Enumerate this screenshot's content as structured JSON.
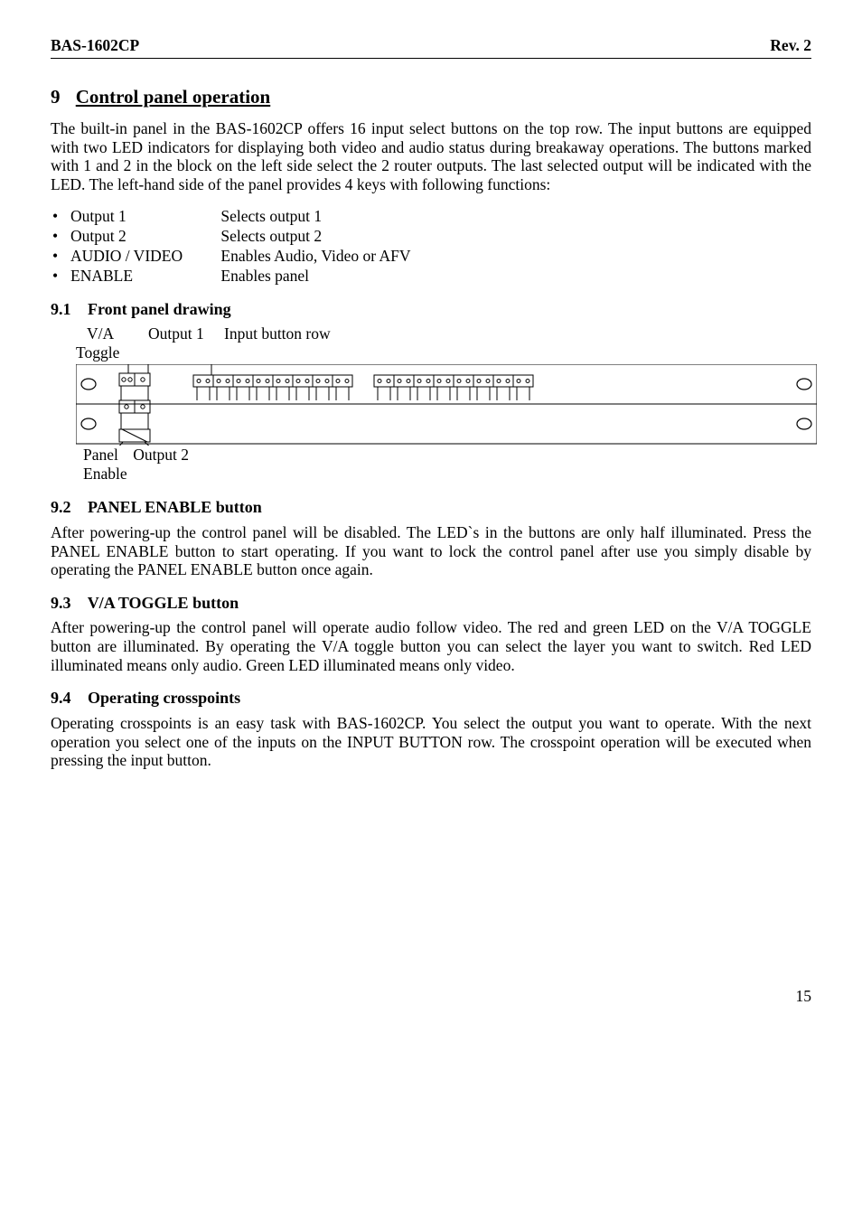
{
  "header": {
    "product": "BAS-1602CP",
    "rev": "Rev. 2"
  },
  "section9": {
    "num": "9",
    "title": "Control panel operation",
    "intro": "The built-in panel in the BAS-1602CP offers 16 input select buttons on the top row. The input buttons are equipped with two LED indicators for displaying both video and audio status during breakaway operations. The buttons marked with 1 and 2 in the block on the left side select the 2 router outputs. The last selected output will be indicated with the LED. The left-hand side of the panel provides 4 keys with following functions:",
    "bullets": [
      {
        "term": "Output 1",
        "desc": "Selects output 1"
      },
      {
        "term": "Output 2",
        "desc": "Selects output 2"
      },
      {
        "term": "AUDIO / VIDEO",
        "desc": "Enables Audio, Video or AFV"
      },
      {
        "term": "ENABLE",
        "desc": "Enables panel"
      }
    ],
    "sub1": {
      "num": "9.1",
      "title": "Front panel drawing"
    },
    "figlabels": {
      "va": "V/A",
      "output1": "Output 1",
      "inputrow": "Input button row",
      "toggle": "Toggle",
      "panel": "Panel",
      "output2": "Output 2",
      "enable": "Enable"
    },
    "sub2": {
      "num": "9.2",
      "title": "PANEL ENABLE button",
      "body": "After powering-up the control panel will be disabled. The LED`s in the buttons are only half illuminated. Press the PANEL ENABLE button to start operating. If you want to lock the control panel after use you simply disable by operating the PANEL ENABLE button once again."
    },
    "sub3": {
      "num": "9.3",
      "title": "V/A TOGGLE button",
      "body": "After powering-up the control panel will operate audio follow video. The red and green LED on the V/A TOGGLE button are illuminated. By operating the V/A toggle button you can select the layer you want to switch. Red LED illuminated means only audio. Green LED illuminated means only video."
    },
    "sub4": {
      "num": "9.4",
      "title": "Operating crosspoints",
      "body": "Operating crosspoints is an easy task with BAS-1602CP. You select the output you want to operate. With the next operation you select one of the inputs on the INPUT BUTTON row. The crosspoint operation will be executed when pressing the input button."
    }
  },
  "page_number": "15"
}
